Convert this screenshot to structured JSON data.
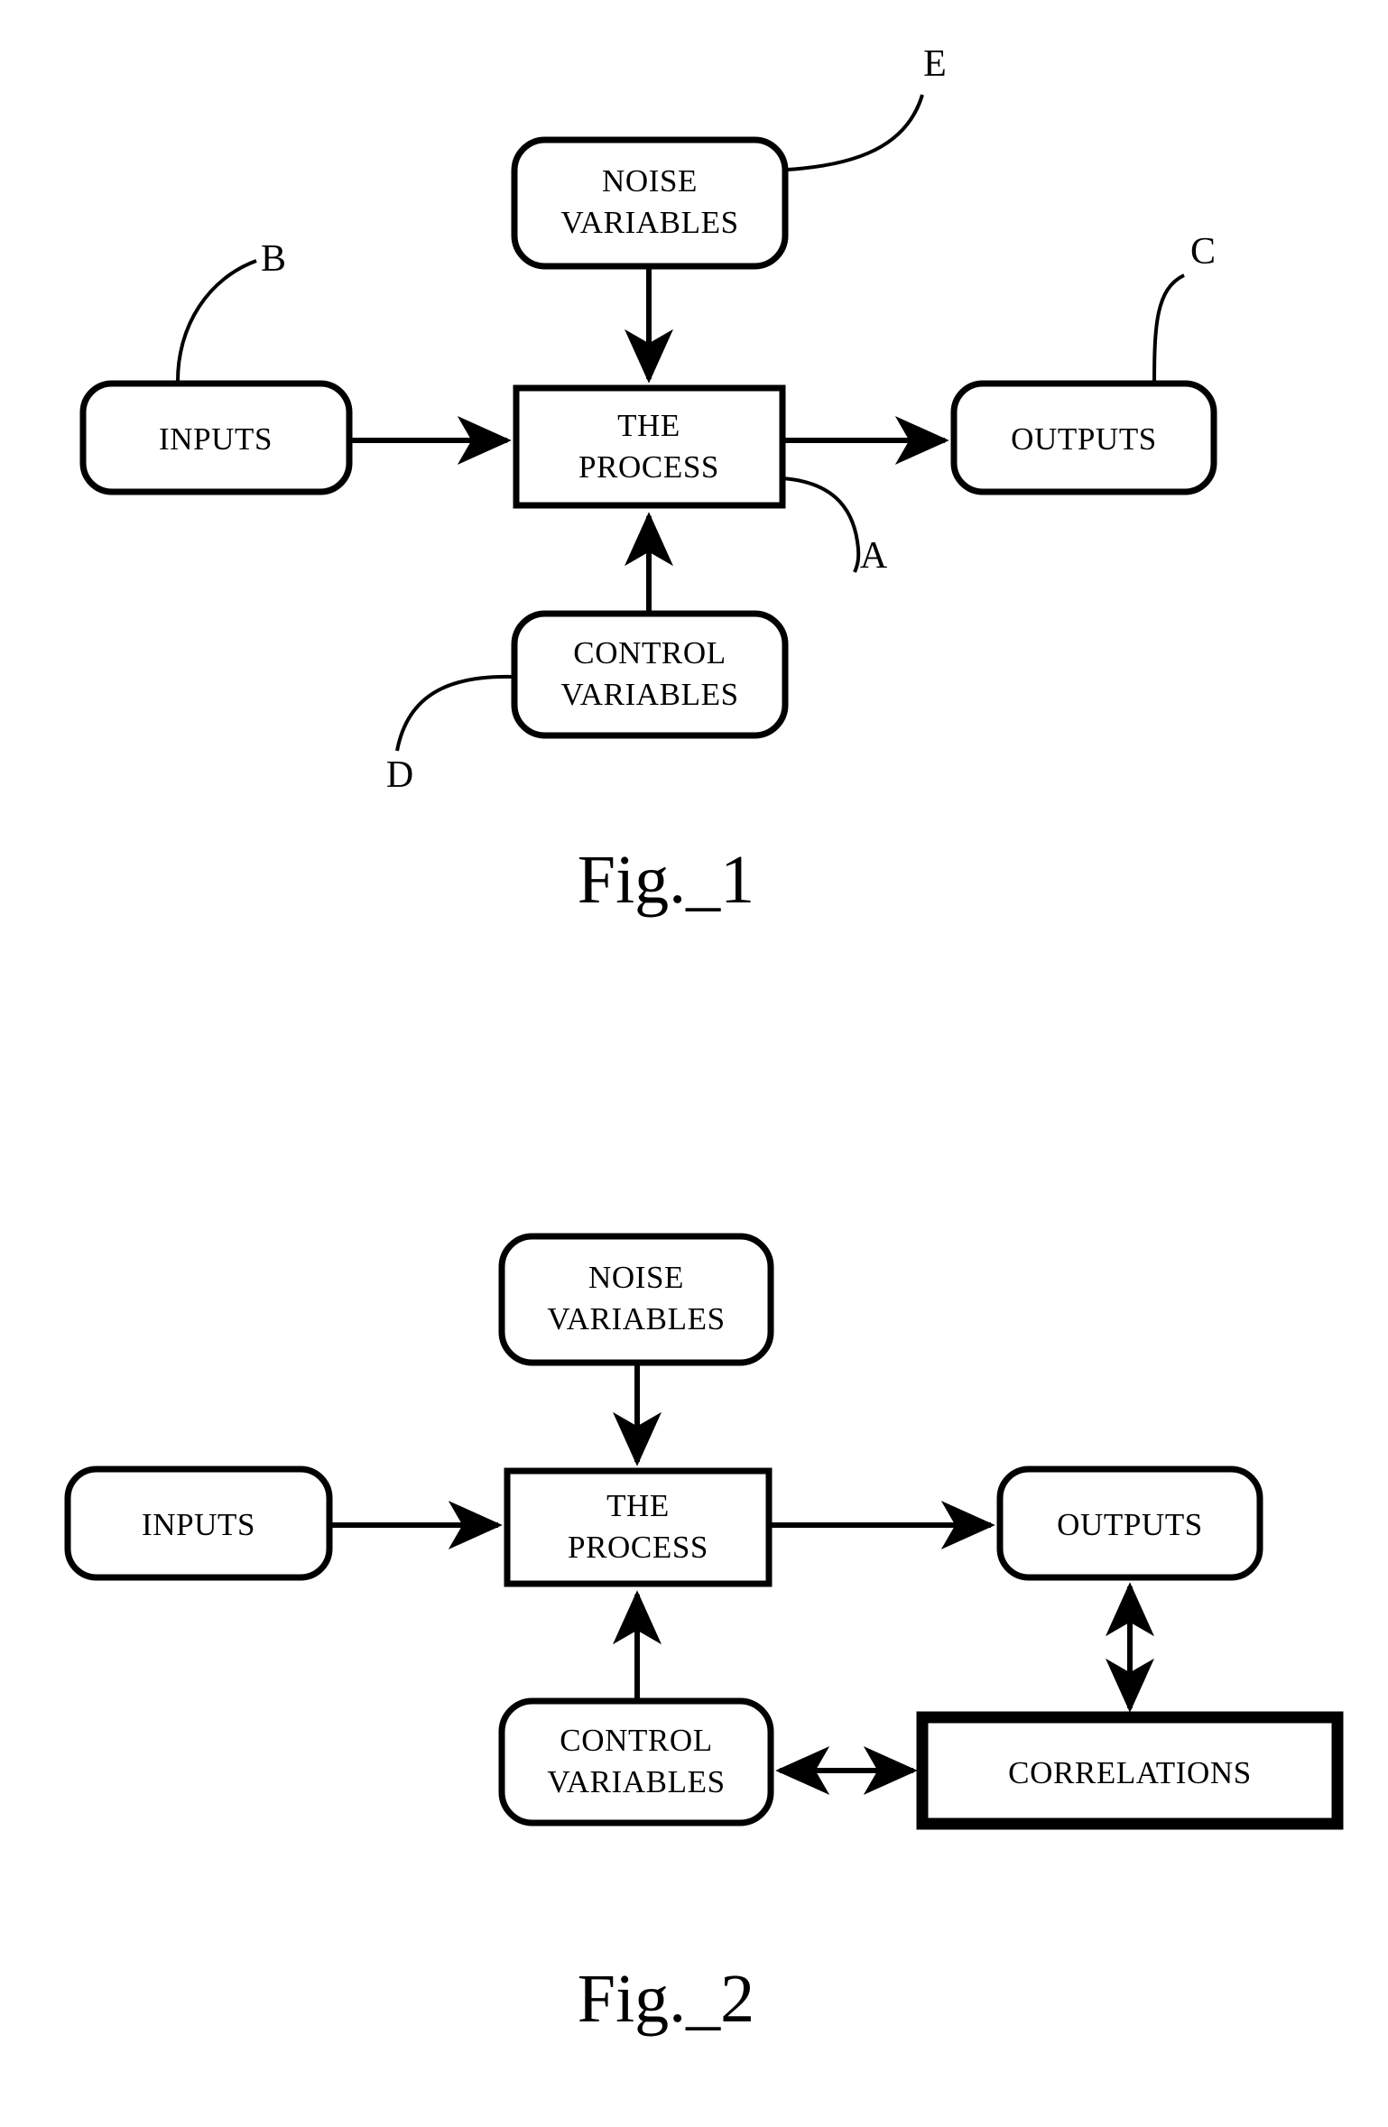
{
  "document": {
    "type": "patent-drawing-sheet",
    "background_color": "#ffffff",
    "ink_color": "#000000"
  },
  "figures": [
    {
      "id": "figure-1",
      "caption": "Fig._1",
      "boxes": {
        "noise": {
          "line1": "NOISE",
          "line2": "VARIABLES"
        },
        "inputs": {
          "line1": "INPUTS"
        },
        "process": {
          "line1": "THE",
          "line2": "PROCESS"
        },
        "outputs": {
          "line1": "OUTPUTS"
        },
        "control": {
          "line1": "CONTROL",
          "line2": "VARIABLES"
        }
      },
      "reference_labels": [
        {
          "key": "a",
          "text": "A",
          "points_to": "process"
        },
        {
          "key": "b",
          "text": "B",
          "points_to": "inputs"
        },
        {
          "key": "c",
          "text": "C",
          "points_to": "outputs"
        },
        {
          "key": "d",
          "text": "D",
          "points_to": "control"
        },
        {
          "key": "e",
          "text": "E",
          "points_to": "noise"
        }
      ]
    },
    {
      "id": "figure-2",
      "caption": "Fig._2",
      "boxes": {
        "noise": {
          "line1": "NOISE",
          "line2": "VARIABLES"
        },
        "inputs": {
          "line1": "INPUTS"
        },
        "process": {
          "line1": "THE",
          "line2": "PROCESS"
        },
        "outputs": {
          "line1": "OUTPUTS"
        },
        "control": {
          "line1": "CONTROL",
          "line2": "VARIABLES"
        },
        "correlations": {
          "line1": "CORRELATIONS"
        }
      },
      "reference_labels": []
    }
  ]
}
